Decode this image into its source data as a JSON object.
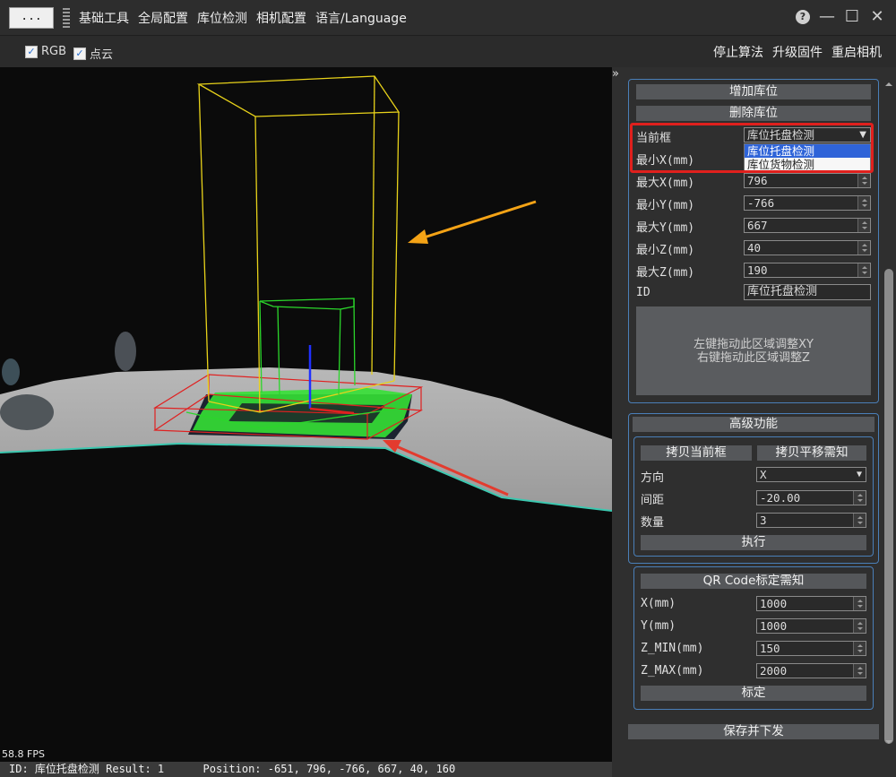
{
  "titlebar": {
    "more_label": "...",
    "menu": [
      "基础工具",
      "全局配置",
      "库位检测",
      "相机配置",
      "语言/Language"
    ],
    "help_icon": "question-circle-icon",
    "minimize_icon": "minimize-icon",
    "maximize_icon": "maximize-icon",
    "close_icon": "close-icon"
  },
  "toolbar": {
    "rgb_label": "RGB",
    "rgb_checked": true,
    "pointcloud_label": "点云",
    "pointcloud_checked": true,
    "stop_algo": "停止算法",
    "upgrade_fw": "升级固件",
    "restart_cam": "重启相机"
  },
  "viewport": {
    "fps": "58.8 FPS",
    "status": "ID: 库位托盘检测 Result: 1      Position: -651, 796, -766, 667, 40, 160",
    "colors": {
      "outer_box": "#e8d21a",
      "inner_box": "#2bd62b",
      "base_box": "#e02020",
      "axis": "#2030ff",
      "arrow_orange": "#f4a316",
      "arrow_red": "#e33b2e"
    }
  },
  "panel": {
    "collapse_icon": "double-chevron-right-icon",
    "add_slot": "增加库位",
    "delete_slot": "删除库位",
    "current_box_label": "当前框",
    "current_box_value": "库位托盘检测",
    "dropdown_options": [
      "库位托盘检测",
      "库位货物检测"
    ],
    "fields": [
      {
        "label": "最小X(mm)",
        "value": ""
      },
      {
        "label": "最大X(mm)",
        "value": "796"
      },
      {
        "label": "最小Y(mm)",
        "value": "-766"
      },
      {
        "label": "最大Y(mm)",
        "value": "667"
      },
      {
        "label": "最小Z(mm)",
        "value": "40"
      },
      {
        "label": "最大Z(mm)",
        "value": "190"
      }
    ],
    "id_label": "ID",
    "id_value": "库位托盘检测",
    "drag_line1": "左键拖动此区域调整XY",
    "drag_line2": "右键拖动此区域调整Z",
    "advanced": {
      "title": "高级功能",
      "copy_current": "拷贝当前框",
      "copy_shift_notice": "拷贝平移需知",
      "direction_label": "方向",
      "direction_value": "X",
      "spacing_label": "间距",
      "spacing_value": "-20.00",
      "count_label": "数量",
      "count_value": "3",
      "execute": "执行"
    },
    "qr": {
      "title": "QR Code标定需知",
      "fields": [
        {
          "label": "X(mm)",
          "value": "1000"
        },
        {
          "label": "Y(mm)",
          "value": "1000"
        },
        {
          "label": "Z_MIN(mm)",
          "value": "150"
        },
        {
          "label": "Z_MAX(mm)",
          "value": "2000"
        }
      ],
      "calibrate": "标定"
    },
    "save_send": "保存并下发"
  }
}
